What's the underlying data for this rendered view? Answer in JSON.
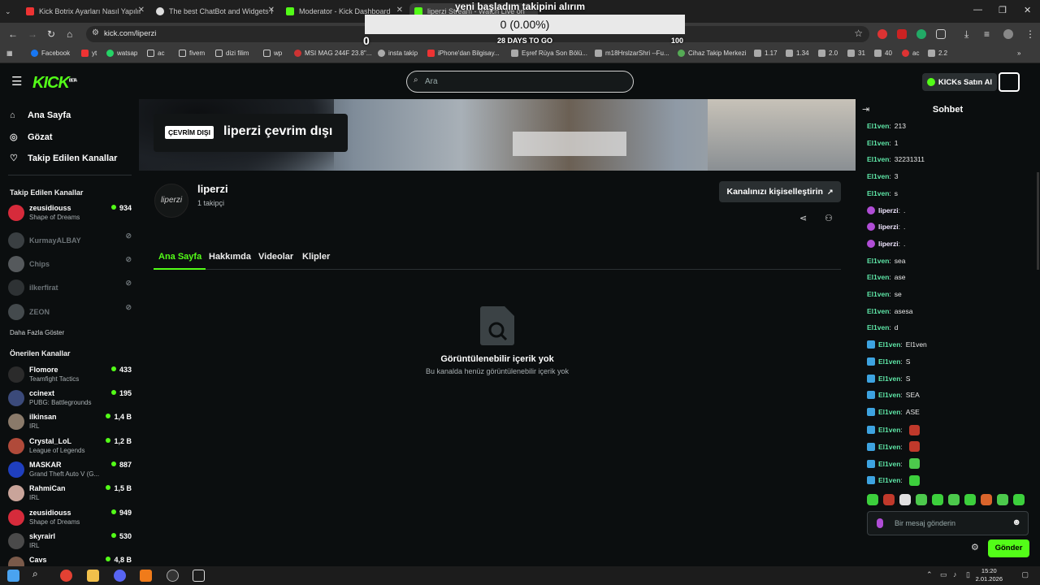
{
  "browser": {
    "tabs": [
      {
        "title": "Kick Botrix Ayarları Nasıl Yapılır",
        "active": false
      },
      {
        "title": "The best ChatBot and Widgets f",
        "active": false
      },
      {
        "title": "Moderator - Kick Dashboard",
        "active": false
      },
      {
        "title": "liperzi Stream - Watch Live on",
        "active": true
      }
    ],
    "url": "kick.com/liperzi",
    "bookmarks": [
      "Facebook",
      "yt",
      "watsap",
      "ac",
      "fivem",
      "dizi filim",
      "wp",
      "MSI MAG 244F 23.8\"...",
      "insta takip",
      "iPhone'dan Bilgisay...",
      "Eşref Rüya Son Bölü...",
      "m18HrslzarShri --Fu...",
      "Cihaz Takip Merkezi",
      "1.17",
      "1.34",
      "2.0",
      "31",
      "40",
      "ac",
      "2.2"
    ]
  },
  "overlay": {
    "title": "yeni başladım takipini alırım",
    "progress_text": "0 (0.00%)",
    "progress": 0,
    "min": "0",
    "days": "28 DAYS TO GO",
    "max": "100"
  },
  "header": {
    "logo": "KICK",
    "logo_sup": "BETA",
    "search_placeholder": "Ara",
    "kicks_button": "KICKs Satın Al"
  },
  "sidebar": {
    "nav": [
      {
        "label": "Ana Sayfa",
        "icon": "home-icon"
      },
      {
        "label": "Gözat",
        "icon": "compass-icon"
      },
      {
        "label": "Takip Edilen Kanallar",
        "icon": "heart-icon"
      }
    ],
    "followed_title": "Takip Edilen Kanallar",
    "followed": [
      {
        "name": "zeusidiouss",
        "game": "Shape of Dreams",
        "viewers": "934",
        "live": true,
        "color": "#d62b3b"
      },
      {
        "name": "KurmayALBAY",
        "game": "",
        "viewers": "",
        "live": false,
        "color": "#3a3f42"
      },
      {
        "name": "Chips",
        "game": "",
        "viewers": "",
        "live": false,
        "color": "#55595c"
      },
      {
        "name": "ilkerfirat",
        "game": "",
        "viewers": "",
        "live": false,
        "color": "#2e3234"
      },
      {
        "name": "ZEON",
        "game": "",
        "viewers": "",
        "live": false,
        "color": "#444a4d"
      }
    ],
    "show_more": "Daha Fazla Göster",
    "recommended_title": "Önerilen Kanallar",
    "recommended": [
      {
        "name": "Flomore",
        "game": "Teamfight Tactics",
        "viewers": "433",
        "color": "#2b2b2b"
      },
      {
        "name": "ccinext",
        "game": "PUBG: Battlegrounds",
        "viewers": "195",
        "color": "#3b4a7a"
      },
      {
        "name": "ilkinsan",
        "game": "IRL",
        "viewers": "1,4 B",
        "color": "#8a7a6a"
      },
      {
        "name": "Crystal_LoL",
        "game": "League of Legends",
        "viewers": "1,2 B",
        "color": "#b04a3a"
      },
      {
        "name": "MASKAR",
        "game": "Grand Theft Auto V (G...",
        "viewers": "887",
        "color": "#1f3fbf"
      },
      {
        "name": "RahmiCan",
        "game": "IRL",
        "viewers": "1,5 B",
        "color": "#c9a49a"
      },
      {
        "name": "zeusidiouss",
        "game": "Shape of Dreams",
        "viewers": "949",
        "color": "#d62b3b"
      },
      {
        "name": "skyrairl",
        "game": "IRL",
        "viewers": "530",
        "color": "#4a4a4a"
      },
      {
        "name": "Cavs",
        "game": "",
        "viewers": "4,8 B",
        "color": "#7a5a4a"
      }
    ]
  },
  "channel": {
    "offline_badge": "ÇEVRİM DIŞI",
    "offline_text": "liperzi çevrim dışı",
    "avatar_text": "liperzi",
    "name": "liperzi",
    "followers": "1 takipçi",
    "customize_button": "Kanalınızı kişiselleştirin",
    "tabs": [
      "Ana Sayfa",
      "Hakkımda",
      "Videolar",
      "Klipler"
    ],
    "empty_title": "Görüntülenebilir içerik yok",
    "empty_subtitle": "Bu kanalda henüz görüntülenebilir içerik yok"
  },
  "chat": {
    "title": "Sohbet",
    "messages": [
      {
        "user": "El1ven",
        "text": "213",
        "badge": "",
        "emote": ""
      },
      {
        "user": "El1ven",
        "text": "1",
        "badge": "",
        "emote": ""
      },
      {
        "user": "El1ven",
        "text": "32231311",
        "badge": "",
        "emote": ""
      },
      {
        "user": "El1ven",
        "text": "3",
        "badge": "",
        "emote": ""
      },
      {
        "user": "El1ven",
        "text": "s",
        "badge": "",
        "emote": ""
      },
      {
        "user": "liperzi",
        "text": ".",
        "badge": "mic",
        "emote": ""
      },
      {
        "user": "liperzi",
        "text": ".",
        "badge": "mic",
        "emote": ""
      },
      {
        "user": "liperzi",
        "text": ".",
        "badge": "mic",
        "emote": ""
      },
      {
        "user": "El1ven",
        "text": "sea",
        "badge": "",
        "emote": ""
      },
      {
        "user": "El1ven",
        "text": "ase",
        "badge": "",
        "emote": ""
      },
      {
        "user": "El1ven",
        "text": "se",
        "badge": "",
        "emote": ""
      },
      {
        "user": "El1ven",
        "text": "asesa",
        "badge": "",
        "emote": ""
      },
      {
        "user": "El1ven",
        "text": "d",
        "badge": "",
        "emote": ""
      },
      {
        "user": "El1ven",
        "text": "El1ven",
        "badge": "arr",
        "emote": ""
      },
      {
        "user": "El1ven",
        "text": "S",
        "badge": "arr",
        "emote": ""
      },
      {
        "user": "El1ven",
        "text": "S",
        "badge": "arr",
        "emote": ""
      },
      {
        "user": "El1ven",
        "text": "SEA",
        "badge": "arr",
        "emote": ""
      },
      {
        "user": "El1ven",
        "text": "ASE",
        "badge": "arr",
        "emote": ""
      },
      {
        "user": "El1ven",
        "text": "",
        "badge": "arr",
        "emote": "#c0392b"
      },
      {
        "user": "El1ven",
        "text": "",
        "badge": "arr",
        "emote": "#c0392b"
      },
      {
        "user": "El1ven",
        "text": "",
        "badge": "arr",
        "emote": "#4cc94c"
      },
      {
        "user": "El1ven",
        "text": "",
        "badge": "arr",
        "emote": "#3ccf3c"
      }
    ],
    "emotes": [
      "#3ccf3c",
      "#c0392b",
      "#e0e0e0",
      "#4cc94c",
      "#3ccf3c",
      "#4cc94c",
      "#3ccf3c",
      "#d9642b",
      "#4cc94c",
      "#3ccf3c"
    ],
    "input_placeholder": "Bir mesaj gönderin",
    "send_button": "Gönder"
  },
  "taskbar": {
    "time": "15:20",
    "date": "2.01.2026"
  }
}
